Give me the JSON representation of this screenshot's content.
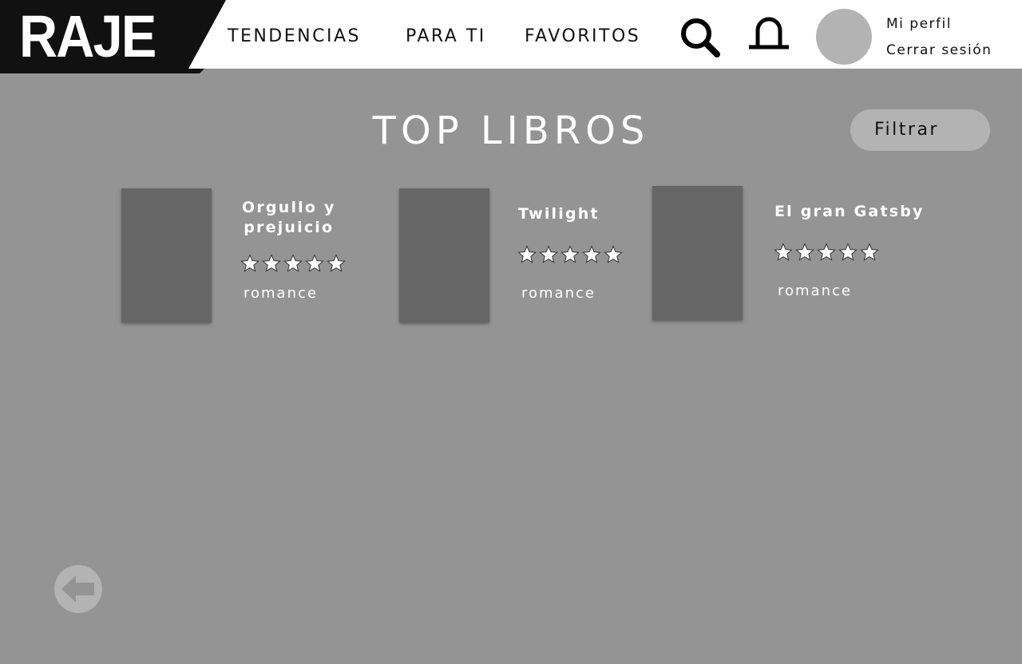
{
  "header": {
    "logo": "RAJE",
    "nav": [
      "TENDENCIAS",
      "PARA TI",
      "FAVORITOS"
    ],
    "profile_link": "Mi perfil",
    "logout_link": "Cerrar sesión",
    "icons": {
      "search": "search-icon",
      "notifications": "bell-icon"
    }
  },
  "main": {
    "title": "TOP LIBROS",
    "filter_label": "Filtrar",
    "books": [
      {
        "title_lines": [
          "Orgullo y",
          "prejuicio"
        ],
        "rating": 5,
        "genre": "romance"
      },
      {
        "title_lines": [
          "Twilight"
        ],
        "rating": 5,
        "genre": "romance"
      },
      {
        "title_lines": [
          "El gran Gatsby"
        ],
        "rating": 5,
        "genre": "romance"
      }
    ],
    "back_icon": "arrow-left-icon"
  },
  "colors": {
    "background": "#949494",
    "header_bg": "#ffffff",
    "logo_bg": "#111111",
    "cover": "#666666",
    "pill": "#b3b3b3",
    "text_light": "#ffffff",
    "text_dark": "#111111"
  }
}
